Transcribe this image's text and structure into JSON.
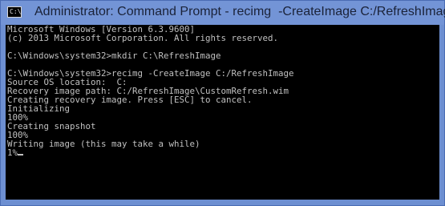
{
  "window": {
    "title": "Administrator: Command Prompt - recimg  -CreateImage C:/RefreshImage",
    "icon": "console-icon",
    "icon_glyph": "C:\\"
  },
  "console": {
    "lines": [
      "Microsoft Windows [Version 6.3.9600]",
      "(c) 2013 Microsoft Corporation. All rights reserved.",
      "",
      "C:\\Windows\\system32>mkdir C:\\RefreshImage",
      "",
      "C:\\Windows\\system32>recimg -CreateImage C:/RefreshImage",
      "Source OS location:  C:",
      "Recovery image path: C:/RefreshImage\\CustomRefresh.wim",
      "Creating recovery image. Press [ESC] to cancel.",
      "Initializing",
      "100%",
      "Creating snapshot",
      "100%",
      "Writing image (this may take a while)",
      "1%"
    ]
  },
  "colors": {
    "titlebar": "#7394d6",
    "console_bg": "#000000",
    "console_text": "#c0c0c0"
  }
}
